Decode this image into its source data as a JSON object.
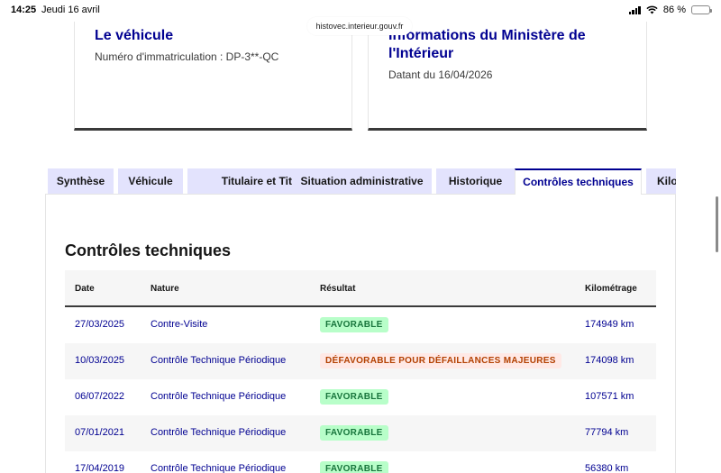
{
  "status_bar": {
    "time": "14:25",
    "date": "Jeudi 16 avril",
    "battery": "86 %",
    "battery_level": 0.86,
    "wifi_icon": "wifi-icon"
  },
  "browser": {
    "url": "histovec.interieur.gouv.fr"
  },
  "cards": {
    "vehicle": {
      "title": "Le véhicule",
      "subtitle": "Numéro d'immatriculation : DP-3**-QC"
    },
    "ministry": {
      "title_line1": "Informations du Ministère de",
      "title_line2": "l'Intérieur",
      "subtitle": "Datant du 16/04/2026"
    }
  },
  "tabs": [
    {
      "label": "Synthèse"
    },
    {
      "label": "Véhicule"
    },
    {
      "label": "Titulaire et Titre"
    },
    {
      "label": "Situation administrative"
    },
    {
      "label": "Historique"
    },
    {
      "label": "Contrôles techniques"
    },
    {
      "label": "Kilom"
    }
  ],
  "active_tab": "Contrôles techniques",
  "section": {
    "title": "Contrôles techniques"
  },
  "table": {
    "headers": {
      "date": "Date",
      "nature": "Nature",
      "result": "Résultat",
      "km": "Kilométrage"
    },
    "rows": [
      {
        "date": "27/03/2025",
        "nature": "Contre-Visite",
        "result": "FAVORABLE",
        "status": "ok",
        "km": "174949 km"
      },
      {
        "date": "10/03/2025",
        "nature": "Contrôle Technique Périodique",
        "result": "DÉFAVORABLE POUR DÉFAILLANCES MAJEURES",
        "status": "ko",
        "km": "174098 km"
      },
      {
        "date": "06/07/2022",
        "nature": "Contrôle Technique Périodique",
        "result": "FAVORABLE",
        "status": "ok",
        "km": "107571 km"
      },
      {
        "date": "07/01/2021",
        "nature": "Contrôle Technique Périodique",
        "result": "FAVORABLE",
        "status": "ok",
        "km": "77794 km"
      },
      {
        "date": "17/04/2019",
        "nature": "Contrôle Technique Périodique",
        "result": "FAVORABLE",
        "status": "ok",
        "km": "56380 km"
      }
    ]
  },
  "colors": {
    "primary": "#000091",
    "tab_bg": "#e3e3fd",
    "success_bg": "#b8fec9",
    "success_text": "#18753c",
    "error_bg": "#ffe9e6",
    "error_text": "#b34000"
  }
}
